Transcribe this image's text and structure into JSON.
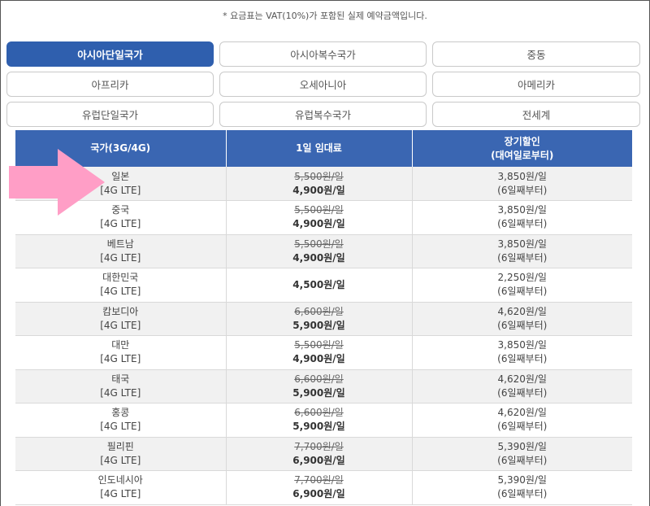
{
  "notice": "* 요금표는 VAT(10%)가 포함된 실제 예약금액입니다.",
  "tabs": [
    {
      "label": "아시아단일국가",
      "active": true
    },
    {
      "label": "아시아복수국가",
      "active": false
    },
    {
      "label": "중동",
      "active": false
    },
    {
      "label": "아프리카",
      "active": false
    },
    {
      "label": "오세아니아",
      "active": false
    },
    {
      "label": "아메리카",
      "active": false
    },
    {
      "label": "유럽단일국가",
      "active": false
    },
    {
      "label": "유럽복수국가",
      "active": false
    },
    {
      "label": "전세계",
      "active": false
    }
  ],
  "table": {
    "headers": {
      "country": "국가(3G/4G)",
      "daily": "1일 임대료",
      "long1": "장기할인",
      "long2": "(대여일로부터)"
    },
    "rows": [
      {
        "country": "일본",
        "network": "[4G LTE]",
        "orig": "5,500원/일",
        "price": "4,900원/일",
        "long": "3,850원/일",
        "from": "(6일째부터)"
      },
      {
        "country": "중국",
        "network": "[4G LTE]",
        "orig": "5,500원/일",
        "price": "4,900원/일",
        "long": "3,850원/일",
        "from": "(6일째부터)"
      },
      {
        "country": "베트남",
        "network": "[4G LTE]",
        "orig": "5,500원/일",
        "price": "4,900원/일",
        "long": "3,850원/일",
        "from": "(6일째부터)"
      },
      {
        "country": "대한민국",
        "network": "[4G LTE]",
        "orig": "",
        "price": "4,500원/일",
        "long": "2,250원/일",
        "from": "(6일째부터)"
      },
      {
        "country": "캄보디아",
        "network": "[4G LTE]",
        "orig": "6,600원/일",
        "price": "5,900원/일",
        "long": "4,620원/일",
        "from": "(6일째부터)"
      },
      {
        "country": "대만",
        "network": "[4G LTE]",
        "orig": "5,500원/일",
        "price": "4,900원/일",
        "long": "3,850원/일",
        "from": "(6일째부터)"
      },
      {
        "country": "태국",
        "network": "[4G LTE]",
        "orig": "6,600원/일",
        "price": "5,900원/일",
        "long": "4,620원/일",
        "from": "(6일째부터)"
      },
      {
        "country": "홍콩",
        "network": "[4G LTE]",
        "orig": "6,600원/일",
        "price": "5,900원/일",
        "long": "4,620원/일",
        "from": "(6일째부터)"
      },
      {
        "country": "필리핀",
        "network": "[4G LTE]",
        "orig": "7,700원/일",
        "price": "6,900원/일",
        "long": "5,390원/일",
        "from": "(6일째부터)"
      },
      {
        "country": "인도네시아",
        "network": "[4G LTE]",
        "orig": "7,700원/일",
        "price": "6,900원/일",
        "long": "5,390원/일",
        "from": "(6일째부터)"
      }
    ]
  },
  "colors": {
    "accent": "#2f5fae",
    "header": "#3a66b2",
    "arrow": "#ff9ec6"
  },
  "icons": {
    "pointer": "right-arrow-icon"
  }
}
